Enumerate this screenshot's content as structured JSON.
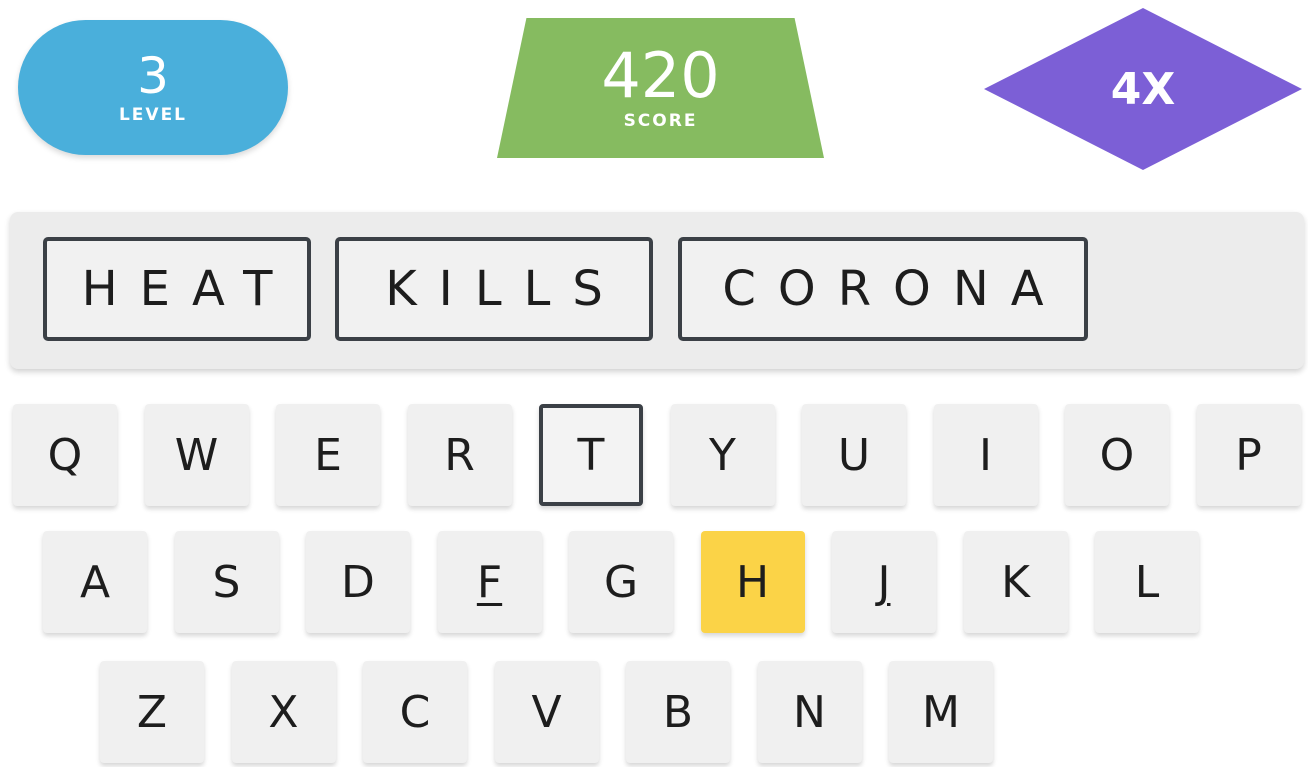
{
  "hud": {
    "level_value": "3",
    "level_label": "LEVEL",
    "score_value": "420",
    "score_label": "SCORE",
    "multiplier": "4X",
    "colors": {
      "level": "#4aafdb",
      "score": "#86bb60",
      "multiplier": "#7c5fd6"
    }
  },
  "phrase": {
    "words": [
      "HEAT",
      "KILLS",
      "CORONA"
    ]
  },
  "keyboard": {
    "row1": [
      "Q",
      "W",
      "E",
      "R",
      "T",
      "Y",
      "U",
      "I",
      "O",
      "P"
    ],
    "row2": [
      "A",
      "S",
      "D",
      "F",
      "G",
      "H",
      "J",
      "K",
      "L"
    ],
    "row3": [
      "Z",
      "X",
      "C",
      "V",
      "B",
      "N",
      "M"
    ],
    "selected_key": "T",
    "highlighted_key": "H",
    "underlined_keys": [
      "F",
      "J"
    ],
    "highlight_color": "#fbd347"
  }
}
